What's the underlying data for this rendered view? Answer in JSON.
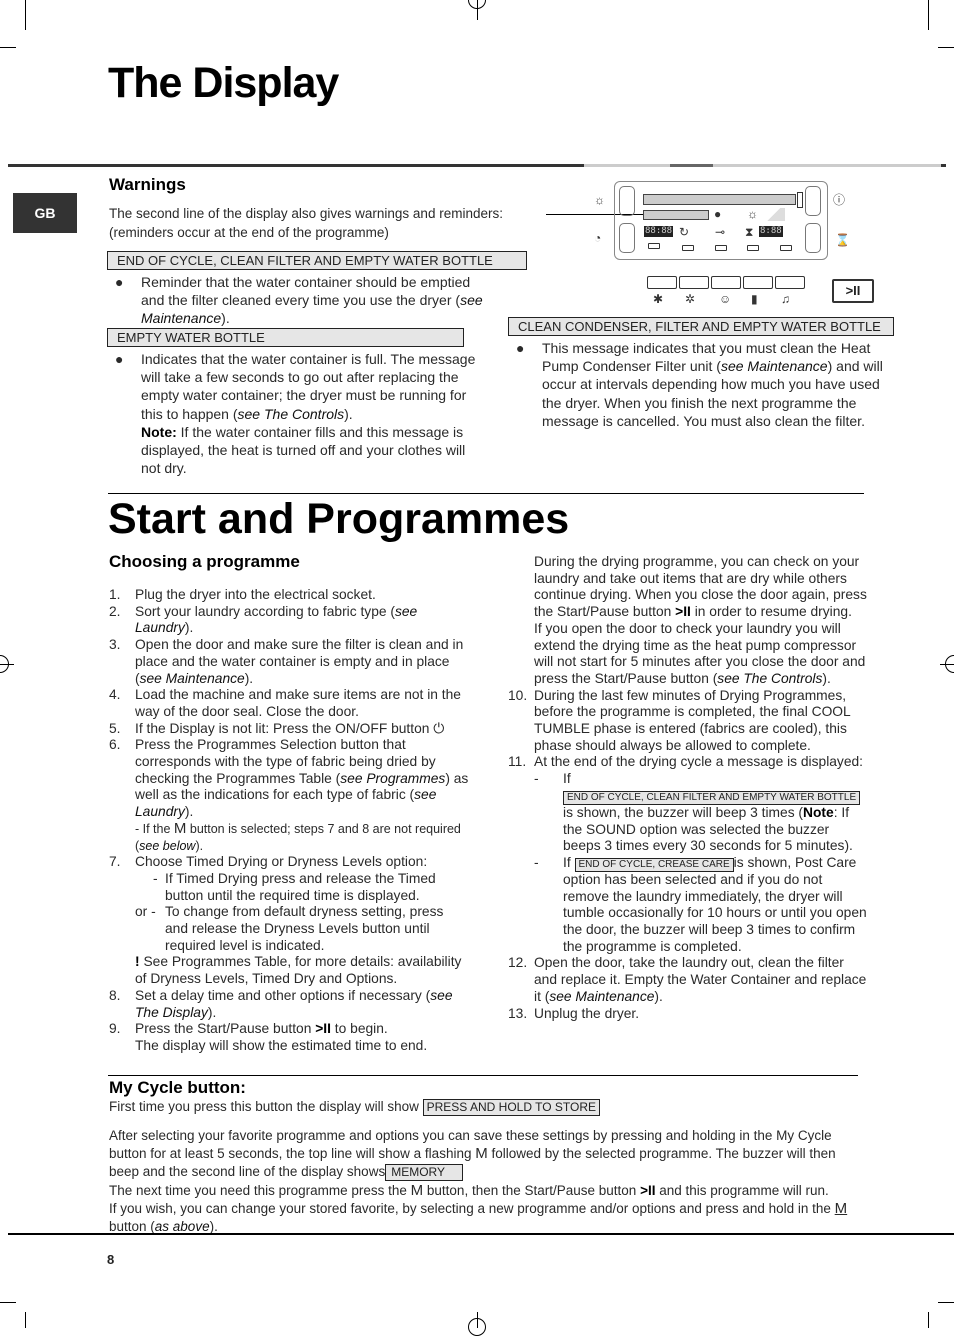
{
  "language_tab": "GB",
  "page_number": "8",
  "display_section": {
    "title": "The Display",
    "warnings": {
      "heading": "Warnings",
      "intro_line1": "The second line of the display also gives warnings and reminders:",
      "intro_line2": "(reminders occur at the end of the programme)",
      "items": [
        {
          "message": "END OF CYCLE, CLEAN FILTER AND EMPTY WATER BOTTLE",
          "text_before": "Reminder that the water container should be emptied and the filter cleaned every time you use the dryer (",
          "link": "see Maintenance",
          "text_after": ")."
        },
        {
          "message": "EMPTY WATER BOTTLE",
          "text_before": "Indicates that the water container is full. The message will take a few seconds to go out after replacing the empty water container; the dryer must be running for this to happen (",
          "link": "see The Controls",
          "text_after": ").",
          "note_label": "Note:",
          "note_text": " If the water container fills and this message is displayed, the heat is turned off and your clothes will not dry."
        },
        {
          "message": "CLEAN CONDENSER, FILTER AND EMPTY WATER BOTTLE",
          "text_before": "This message indicates that you must clean the Heat Pump Condenser Filter unit (",
          "link": "see Maintenance",
          "text_after": ") and will occur at intervals depending how much you have used the dryer. When you finish the next programme the message is cancelled. You must also clean the filter."
        }
      ]
    },
    "panel": {
      "left_icons": [
        "sun-icon",
        "clock-icon"
      ],
      "right_icons": [
        "thermometer-icon",
        "hourglass-icon"
      ],
      "seg_time": "88:88",
      "seg_delay": "8:88",
      "bottom_button_icons": [
        "cotton-icon",
        "synthetics-icon",
        "baby-icon",
        "bottle-icon",
        "bell-icon"
      ],
      "start_pause_glyph": ">II"
    }
  },
  "start_section": {
    "title": "Start and Programmes",
    "choosing": {
      "heading": "Choosing a programme",
      "steps": [
        {
          "n": "1.",
          "parts": [
            {
              "t": "Plug the dryer into the electrical socket."
            }
          ]
        },
        {
          "n": "2.",
          "parts": [
            {
              "t": "Sort your laundry according to fabric type ("
            },
            {
              "i": "see Laundry"
            },
            {
              "t": ")."
            }
          ]
        },
        {
          "n": "3.",
          "parts": [
            {
              "t": "Open the door and make sure the filter is clean and in place and the water container is empty and in place ("
            },
            {
              "i": "see Maintenance"
            },
            {
              "t": ")."
            }
          ]
        },
        {
          "n": "4.",
          "parts": [
            {
              "t": "Load the machine and make sure items are not in the way of the door seal. Close the door."
            }
          ]
        },
        {
          "n": "5.",
          "parts": [
            {
              "t": "If the Display is not lit: Press the ON/OFF button "
            },
            {
              "t": "⏻"
            }
          ]
        },
        {
          "n": "6.",
          "parts": [
            {
              "t": "Press the Programmes Selection button that corresponds with the type of fabric being dried by checking the Programmes Table ("
            },
            {
              "i": "see Programmes"
            },
            {
              "t": ") as well as the indications for each type of fabric ("
            },
            {
              "i": "see Laundry"
            },
            {
              "t": ")."
            }
          ]
        }
      ],
      "step6_note": {
        "before": "- If the ",
        "glyph": "M",
        "after": " button is selected; steps 7 and 8 are not required (",
        "link": "see below",
        "end": ")."
      },
      "step7": {
        "n": "7.",
        "text": "Choose Timed Drying or Dryness Levels option:",
        "options": [
          {
            "dash": "-",
            "text": "If Timed Drying press and release the Timed button until the required time is displayed."
          },
          {
            "dash": "or -",
            "text": "To change from default dryness setting, press and release the Dryness Levels button until required level is indicated."
          }
        ],
        "notice_mark": "!",
        "notice": " See Programmes Table, for more details: availability of Dryness Levels, Timed Dry and Options."
      },
      "step8": {
        "n": "8.",
        "text": "Set a delay time and other options if necessary (",
        "link": "see The Display",
        "end": ")."
      },
      "step9": {
        "n": "9.",
        "before": "Press the Start/Pause button ",
        "glyph": ">II",
        "after": " to begin.",
        "line2": "The display will show the estimated time to end."
      }
    },
    "right_column": {
      "para1_before": "During the drying programme, you can check on your laundry and take out items that are dry while others continue drying. When you close the door again, press the Start/Pause button ",
      "para1_glyph": ">II",
      "para1_after": " in order to resume drying.",
      "para2_before": "If you open the door to check your laundry you will extend the drying time as the heat pump compressor will not start for 5 minutes after you close the door and press the Start/Pause button (",
      "para2_link": "see The Controls",
      "para2_after": ").",
      "step10": {
        "n": "10.",
        "text": "During the last few minutes of Drying Programmes, before the programme is completed, the final COOL TUMBLE phase is entered (fabrics are cooled), this phase should always be allowed to complete."
      },
      "step11": {
        "n": "11.",
        "text": "At the end of the drying cycle a message is displayed:",
        "sub1": {
          "dash": "-",
          "if": "If ",
          "message": "END OF CYCLE, CLEAN FILTER AND EMPTY WATER BOTTLE",
          "before": "is shown, the buzzer will beep 3 times (",
          "note_label": "Note",
          "after": ": If the SOUND option was selected the buzzer beeps 3 times every 30 seconds for 5 minutes)."
        },
        "sub2": {
          "dash": "-",
          "if": "If ",
          "message": "END OF CYCLE, CREASE CARE",
          "after": "is shown, Post Care option has been selected and if you do not remove the laundry immediately, the dryer will tumble occasionally for 10 hours or until you open the door, the buzzer will beep 3 times to confirm the programme is completed."
        }
      },
      "step12": {
        "n": "12.",
        "text": "Open the door, take the laundry out, clean the filter and replace it. Empty the Water Container and replace it (",
        "link": "see Maintenance",
        "end": ")."
      },
      "step13": {
        "n": "13.",
        "text": "Unplug the dryer."
      }
    },
    "my_cycle": {
      "heading": "My Cycle button:",
      "line1": "First time you press this button the display will show ",
      "line1_message": "PRESS AND HOLD TO STORE",
      "p1": "After selecting your favorite programme and options you can save these settings by pressing and holding in the My Cycle button for at least 5 seconds, the top line will show a flashing ",
      "p1_glyph": "M",
      "p1_after": " followed by the selected programme. The buzzer will then beep and the second line of the display shows",
      "p1_message": "MEMORY",
      "p2_before": "The next time you need this programme press the ",
      "p2_glyph": "M",
      "p2_mid": " button, then the Start/Pause button ",
      "p2_glyph2": ">II",
      "p2_after": " and this programme will run.",
      "p3_before": "If you wish, you can change your stored favorite, by selecting a new programme and/or options and press and hold in the ",
      "p3_glyph": "M",
      "p3_mid": " button (",
      "p3_link": "as above",
      "p3_end": ")."
    }
  }
}
